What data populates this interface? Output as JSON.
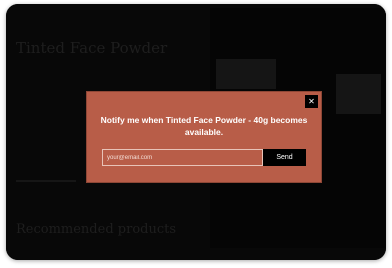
{
  "background": {
    "title": "Tinted Face Powder",
    "section_heading": "Recommended products"
  },
  "modal": {
    "close_label": "✕",
    "title": "Notify me when Tinted Face Powder - 40g becomes available.",
    "email_placeholder": "your@email.com",
    "email_value": "",
    "send_label": "Send"
  },
  "colors": {
    "modal_bg": "#b85d48",
    "overlay": "#000000",
    "button_bg": "#000000",
    "text": "#ffffff"
  },
  "icons": {
    "close": "close-icon"
  }
}
